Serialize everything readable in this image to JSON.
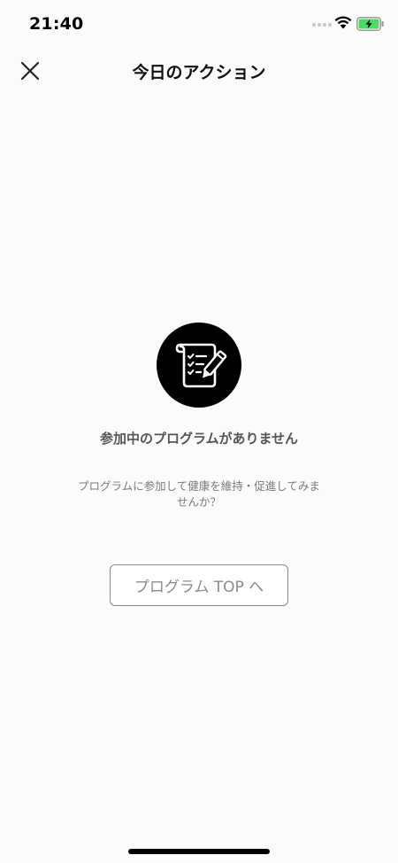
{
  "status_bar": {
    "time": "21:40"
  },
  "nav": {
    "title": "今日のアクション",
    "close_icon": "close-icon"
  },
  "empty_state": {
    "icon": "checklist-pencil-icon",
    "title": "参加中のプログラムがありません",
    "description_line1": "プログラムに参加して健康を維持・促進してみま",
    "description_line2": "せんか？",
    "button_label": "プログラム TOP へ"
  },
  "colors": {
    "background": "#fbfbfb",
    "text_primary": "#111111",
    "text_secondary": "#555555",
    "button_border": "#8a8a8a",
    "battery_fill": "#4cd964"
  }
}
